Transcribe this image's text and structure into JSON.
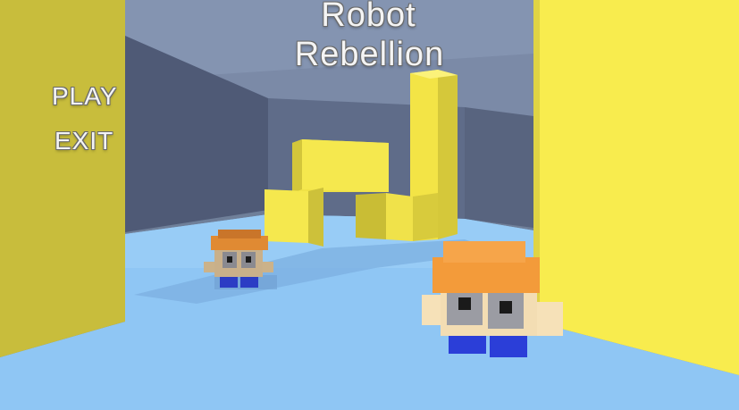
{
  "game": {
    "title_line1": "Robot",
    "title_line2": "Rebellion"
  },
  "menu": {
    "play_label": "PLAY",
    "exit_label": "EXIT"
  },
  "colors": {
    "sky_back_wall": "#5b6886",
    "floor": "#8cc2f2",
    "yellow_wall": "#f7ea4a",
    "yellow_shadow": "#c9bd3a",
    "robot_hat": "#f29a3a",
    "robot_body": "#f3ddb3",
    "robot_legs": "#2f3fe0"
  },
  "icons": {
    "robot_near": "robot-icon",
    "robot_far": "robot-icon"
  }
}
